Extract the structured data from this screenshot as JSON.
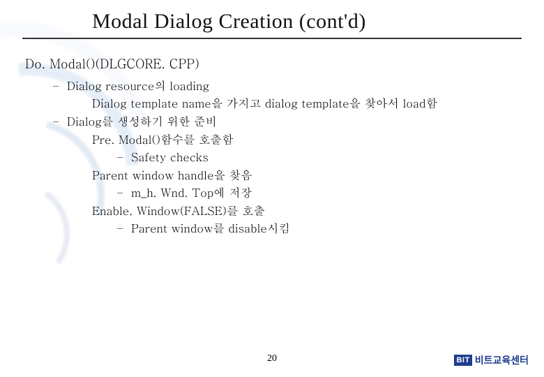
{
  "title": "Modal Dialog Creation (cont'd)",
  "heading": "Do. Modal()(DLGCORE. CPP)",
  "bullets": [
    {
      "text": "Dialog resource의 loading",
      "children": [
        {
          "text": "Dialog template name을 가지고 dialog template을 찾아서 load함"
        }
      ]
    },
    {
      "text": "Dialog를 생성하기 위한 준비",
      "children": [
        {
          "text": "Pre. Modal()함수를 호출함",
          "children": [
            {
              "text": "Safety checks"
            }
          ]
        },
        {
          "text": "Parent window handle을 찾음",
          "children": [
            {
              "text": "m_h. Wnd. Top에 저장"
            }
          ]
        },
        {
          "text": "Enable. Window(FALSE)를 호출",
          "children": [
            {
              "text": "Parent window를 disable시킴"
            }
          ]
        }
      ]
    }
  ],
  "page_number": "20",
  "footer": {
    "logo_abbrev": "BIT",
    "logo_text": "비트교육센터"
  }
}
